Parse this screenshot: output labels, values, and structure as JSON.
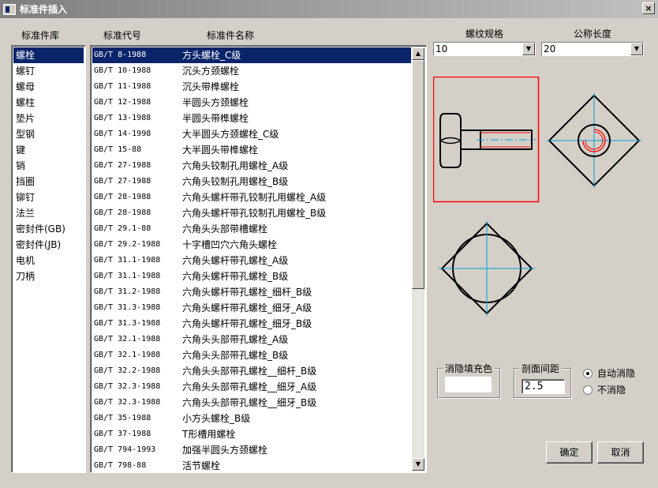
{
  "window": {
    "title": "标准件插入",
    "close_glyph": "×"
  },
  "headers": {
    "library": "标准件库",
    "code": "标准代号",
    "name": "标准件名称",
    "thread": "螺纹规格",
    "length": "公称长度"
  },
  "library_items": [
    "螺栓",
    "螺钉",
    "螺母",
    "螺柱",
    "垫片",
    "型钢",
    "键",
    "销",
    "挡圈",
    "铆钉",
    "法兰",
    "密封件(GB)",
    "密封件(JB)",
    "电机",
    "刀柄"
  ],
  "standards": [
    {
      "code": "GB/T 8-1988",
      "name": "方头螺栓_C级"
    },
    {
      "code": "GB/T 10-1988",
      "name": "沉头方颈螺栓"
    },
    {
      "code": "GB/T 11-1988",
      "name": "沉头带榫螺栓"
    },
    {
      "code": "GB/T 12-1988",
      "name": "半圆头方颈螺栓"
    },
    {
      "code": "GB/T 13-1988",
      "name": "半圆头带榫螺栓"
    },
    {
      "code": "GB/T 14-1998",
      "name": "大半圆头方颈螺栓_C级"
    },
    {
      "code": "GB/T 15-88",
      "name": "大半圆头带榫螺栓"
    },
    {
      "code": "GB/T 27-1988",
      "name": "六角头铰制孔用螺栓_A级"
    },
    {
      "code": "GB/T 27-1988",
      "name": "六角头铰制孔用螺栓_B级"
    },
    {
      "code": "GB/T 28-1988",
      "name": "六角头螺杆带孔铰制孔用螺栓_A级"
    },
    {
      "code": "GB/T 28-1988",
      "name": "六角头螺杆带孔铰制孔用螺栓_B级"
    },
    {
      "code": "GB/T 29.1-88",
      "name": "六角头头部带槽螺栓"
    },
    {
      "code": "GB/T 29.2-1988",
      "name": "十字槽凹穴六角头螺栓"
    },
    {
      "code": "GB/T 31.1-1988",
      "name": "六角头螺杆带孔螺栓_A级"
    },
    {
      "code": "GB/T 31.1-1988",
      "name": "六角头螺杆带孔螺栓_B级"
    },
    {
      "code": "GB/T 31.2-1988",
      "name": "六角头螺杆带孔螺栓_细杆_B级"
    },
    {
      "code": "GB/T 31.3-1988",
      "name": "六角头螺杆带孔螺栓_细牙_A级"
    },
    {
      "code": "GB/T 31.3-1988",
      "name": "六角头螺杆带孔螺栓_细牙_B级"
    },
    {
      "code": "GB/T 32.1-1988",
      "name": "六角头头部带孔螺栓_A级"
    },
    {
      "code": "GB/T 32.1-1988",
      "name": "六角头头部带孔螺栓_B级"
    },
    {
      "code": "GB/T 32.2-1988",
      "name": "六角头头部带孔螺栓__细杆_B级"
    },
    {
      "code": "GB/T 32.3-1988",
      "name": "六角头头部带孔螺栓__细牙_A级"
    },
    {
      "code": "GB/T 32.3-1988",
      "name": "六角头头部带孔螺栓__细牙_B级"
    },
    {
      "code": "GB/T 35-1988",
      "name": "小方头螺栓_B级"
    },
    {
      "code": "GB/T 37-1988",
      "name": "T形槽用螺栓"
    },
    {
      "code": "GB/T 794-1993",
      "name": "加强半圆头方颈螺栓"
    },
    {
      "code": "GB/T 798-88",
      "name": "活节螺栓"
    }
  ],
  "thread_spec": {
    "value": "10"
  },
  "nominal_length": {
    "value": "20"
  },
  "hidden_fill": {
    "label": "消隐填充色",
    "value": ""
  },
  "section_gap": {
    "label": "剖面间距",
    "value": "2.5"
  },
  "radio": {
    "auto": "自动消隐",
    "none": "不消隐",
    "selected": "auto"
  },
  "buttons": {
    "ok": "确定",
    "cancel": "取消"
  },
  "colors": {
    "selection": "#0a246a",
    "preview_border": "#ff0000",
    "center_line": "#00a0e0",
    "section_red": "#ff0000"
  },
  "icons": {
    "up": "▲",
    "down": "▼",
    "dropdown": "▼"
  }
}
